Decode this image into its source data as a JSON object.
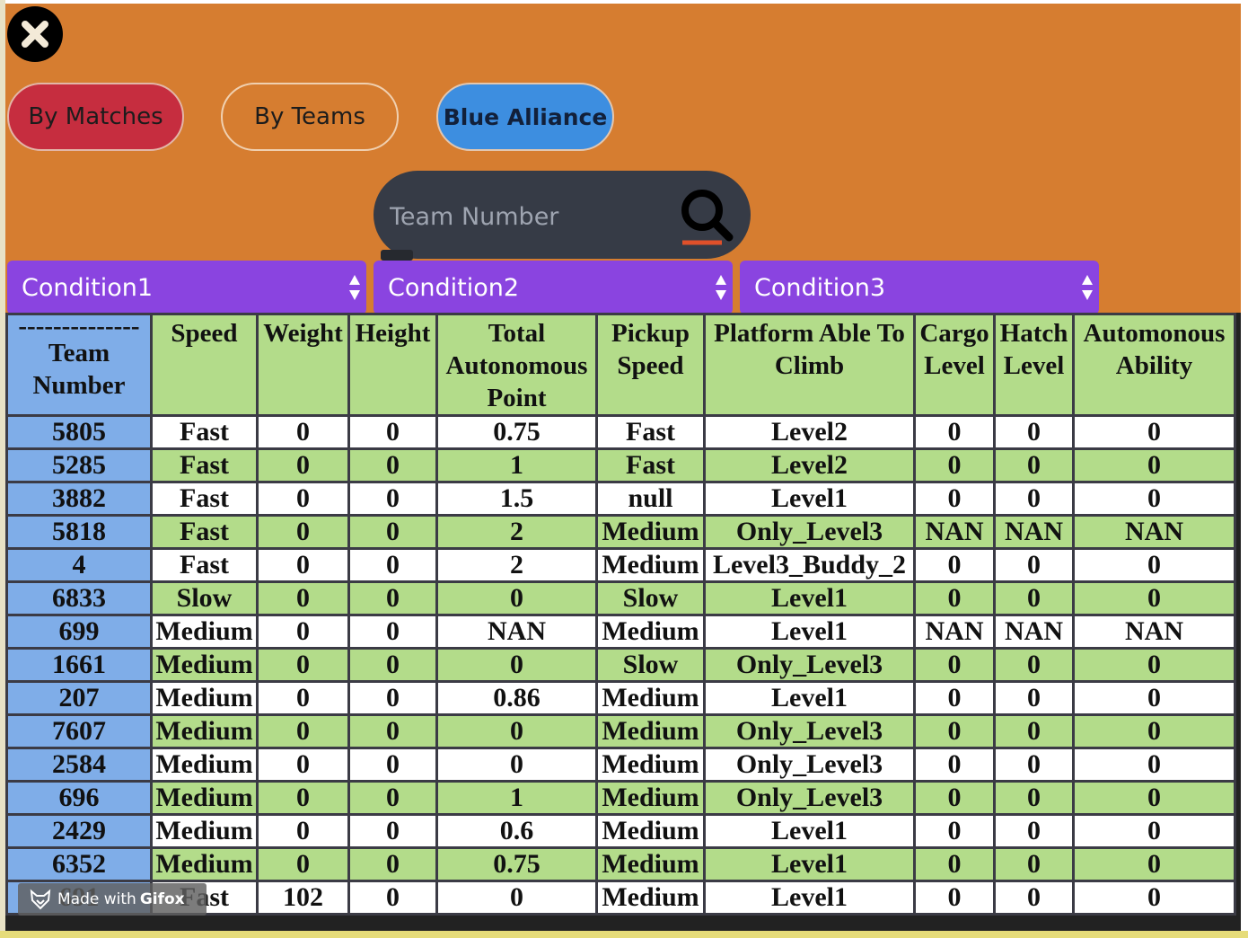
{
  "toolbar": {
    "close_icon": "close-x-icon",
    "by_matches_label": "By Matches",
    "by_teams_label": "By Teams",
    "blue_alliance_label": "Blue Alliance"
  },
  "search": {
    "placeholder": "Team Number",
    "icon": "search-icon"
  },
  "filters": [
    {
      "label": "Condition1"
    },
    {
      "label": "Condition2"
    },
    {
      "label": "Condition3"
    }
  ],
  "colors": {
    "background": "#d67d30",
    "by_matches": "#c62d3f",
    "blue_alliance": "#3d8ee0",
    "select": "#8a44e0",
    "green_row": "#b3dc8a",
    "team_cell": "#7fade8"
  },
  "table": {
    "team_header_dashes": "--------------",
    "headers": [
      "Team Number",
      "Speed",
      "Weight",
      "Height",
      "Total Autonomous Point",
      "Pickup Speed",
      "Platform Able To Climb",
      "Cargo Level",
      "Hatch Level",
      "Automonous Ability"
    ],
    "rows": [
      [
        "5805",
        "Fast",
        "0",
        "0",
        "0.75",
        "Fast",
        "Level2",
        "0",
        "0",
        "0"
      ],
      [
        "5285",
        "Fast",
        "0",
        "0",
        "1",
        "Fast",
        "Level2",
        "0",
        "0",
        "0"
      ],
      [
        "3882",
        "Fast",
        "0",
        "0",
        "1.5",
        "null",
        "Level1",
        "0",
        "0",
        "0"
      ],
      [
        "5818",
        "Fast",
        "0",
        "0",
        "2",
        "Medium",
        "Only_Level3",
        "NAN",
        "NAN",
        "NAN"
      ],
      [
        "4",
        "Fast",
        "0",
        "0",
        "2",
        "Medium",
        "Level3_Buddy_2",
        "0",
        "0",
        "0"
      ],
      [
        "6833",
        "Slow",
        "0",
        "0",
        "0",
        "Slow",
        "Level1",
        "0",
        "0",
        "0"
      ],
      [
        "699",
        "Medium",
        "0",
        "0",
        "NAN",
        "Medium",
        "Level1",
        "NAN",
        "NAN",
        "NAN"
      ],
      [
        "1661",
        "Medium",
        "0",
        "0",
        "0",
        "Slow",
        "Only_Level3",
        "0",
        "0",
        "0"
      ],
      [
        "207",
        "Medium",
        "0",
        "0",
        "0.86",
        "Medium",
        "Level1",
        "0",
        "0",
        "0"
      ],
      [
        "7607",
        "Medium",
        "0",
        "0",
        "0",
        "Medium",
        "Only_Level3",
        "0",
        "0",
        "0"
      ],
      [
        "2584",
        "Medium",
        "0",
        "0",
        "0",
        "Medium",
        "Only_Level3",
        "0",
        "0",
        "0"
      ],
      [
        "696",
        "Medium",
        "0",
        "0",
        "1",
        "Medium",
        "Only_Level3",
        "0",
        "0",
        "0"
      ],
      [
        "2429",
        "Medium",
        "0",
        "0",
        "0.6",
        "Medium",
        "Level1",
        "0",
        "0",
        "0"
      ],
      [
        "6352",
        "Medium",
        "0",
        "0",
        "0.75",
        "Medium",
        "Level1",
        "0",
        "0",
        "0"
      ],
      [
        "691",
        "Fast",
        "102",
        "0",
        "0",
        "Medium",
        "Level1",
        "0",
        "0",
        "0"
      ]
    ]
  },
  "watermark": {
    "made_with": "Made with ",
    "brand": "Gifox"
  }
}
